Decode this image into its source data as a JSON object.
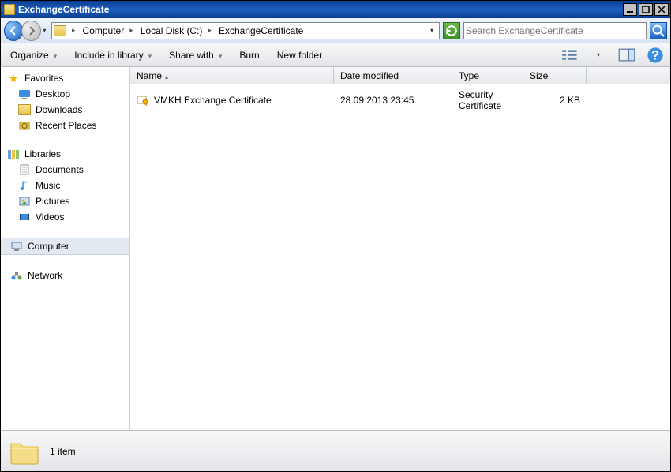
{
  "window": {
    "title": "ExchangeCertificate"
  },
  "breadcrumb": [
    {
      "label": "Computer"
    },
    {
      "label": "Local Disk (C:)"
    },
    {
      "label": "ExchangeCertificate"
    }
  ],
  "search": {
    "placeholder": "Search ExchangeCertificate"
  },
  "toolbar": {
    "organize": "Organize",
    "include": "Include in library",
    "share": "Share with",
    "burn": "Burn",
    "newfolder": "New folder"
  },
  "sidebar": {
    "favorites": {
      "label": "Favorites",
      "items": [
        {
          "label": "Desktop",
          "icon": "desktop"
        },
        {
          "label": "Downloads",
          "icon": "downloads"
        },
        {
          "label": "Recent Places",
          "icon": "recent"
        }
      ]
    },
    "libraries": {
      "label": "Libraries",
      "items": [
        {
          "label": "Documents",
          "icon": "documents"
        },
        {
          "label": "Music",
          "icon": "music"
        },
        {
          "label": "Pictures",
          "icon": "pictures"
        },
        {
          "label": "Videos",
          "icon": "videos"
        }
      ]
    },
    "computer": {
      "label": "Computer"
    },
    "network": {
      "label": "Network"
    }
  },
  "columns": {
    "name": "Name",
    "date": "Date modified",
    "type": "Type",
    "size": "Size"
  },
  "files": [
    {
      "name": "VMKH Exchange Certificate",
      "date": "28.09.2013 23:45",
      "type": "Security Certificate",
      "size": "2 KB"
    }
  ],
  "status": {
    "count": "1 item"
  }
}
